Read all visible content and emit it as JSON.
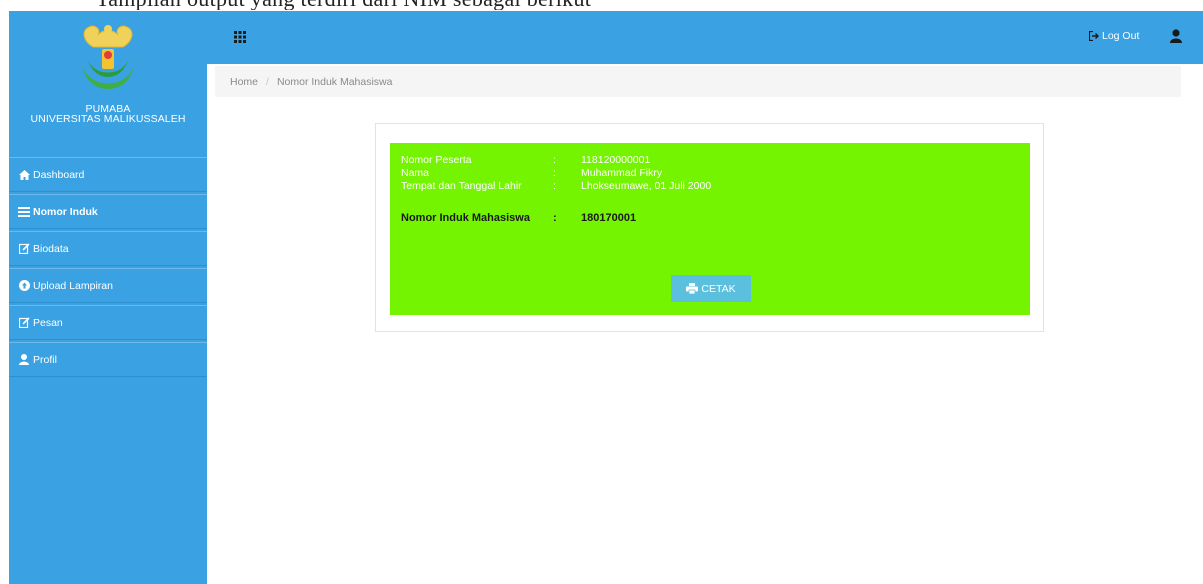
{
  "caption": "Tampilan output yang terdiri dari NIM sebagai berikut",
  "brand": {
    "line1": "PUMABA",
    "line2": "UNIVERSITAS MALIKUSSALEH"
  },
  "sidebar": {
    "items": [
      {
        "label": "Dashboard",
        "icon": "home-icon"
      },
      {
        "label": "Nomor Induk",
        "icon": "list-icon"
      },
      {
        "label": "Biodata",
        "icon": "edit-icon"
      },
      {
        "label": "Upload Lampiran",
        "icon": "upload-icon"
      },
      {
        "label": "Pesan",
        "icon": "edit-icon"
      },
      {
        "label": "Profil",
        "icon": "user-icon"
      }
    ]
  },
  "topbar": {
    "logout_label": "Log Out"
  },
  "breadcrumb": {
    "home": "Home",
    "separator": "/",
    "current": "Nomor Induk Mahasiswa"
  },
  "card": {
    "rows": [
      {
        "label": "Nomor Peserta",
        "colon": ":",
        "value": "118120000001"
      },
      {
        "label": "Nama",
        "colon": ":",
        "value": "Muhammad Fikry"
      },
      {
        "label": "Tempat dan Tanggal Lahir",
        "colon": ":",
        "value": "Lhokseumawe, 01 Juli 2000"
      }
    ],
    "nim": {
      "label": "Nomor Induk Mahasiswa",
      "colon": ":",
      "value": "180170001"
    },
    "print_label": "CETAK"
  },
  "colors": {
    "primary": "#3aa2e3",
    "card_bg": "#74f400",
    "button": "#5bc0de",
    "breadcrumb_bg": "#f5f5f5"
  }
}
